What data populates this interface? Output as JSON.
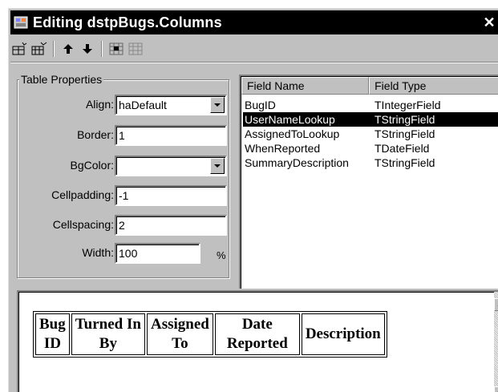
{
  "window": {
    "title": "Editing dstpBugs.Columns",
    "close_glyph": "✕"
  },
  "toolbar": {
    "buttons": [
      {
        "icon": "add-field-icon"
      },
      {
        "icon": "add-all-fields-icon"
      },
      {
        "icon": "move-up-icon"
      },
      {
        "icon": "move-down-icon"
      },
      {
        "icon": "select-all-icon"
      },
      {
        "icon": "grid-icon"
      }
    ]
  },
  "properties": {
    "group_label": "Table Properties",
    "align": {
      "label": "Align:",
      "value": "haDefault"
    },
    "border": {
      "label": "Border:",
      "value": "1"
    },
    "bgcolor": {
      "label": "BgColor:",
      "value": ""
    },
    "cellpadding": {
      "label": "Cellpadding:",
      "value": "-1"
    },
    "cellspacing": {
      "label": "Cellspacing:",
      "value": "2"
    },
    "width": {
      "label": "Width:",
      "value": "100",
      "unit": "%"
    }
  },
  "fields": {
    "columns": [
      "Field Name",
      "Field Type"
    ],
    "rows": [
      {
        "name": "BugID",
        "type": "TIntegerField",
        "selected": false
      },
      {
        "name": "UserNameLookup",
        "type": "TStringField",
        "selected": true
      },
      {
        "name": "AssignedToLookup",
        "type": "TStringField",
        "selected": false
      },
      {
        "name": "WhenReported",
        "type": "TDateField",
        "selected": false
      },
      {
        "name": "SummaryDescription",
        "type": "TStringField",
        "selected": false
      }
    ]
  },
  "preview": {
    "headers": [
      {
        "line1": "Bug",
        "line2": "ID"
      },
      {
        "line1": "Turned In",
        "line2": "By"
      },
      {
        "line1": "Assigned",
        "line2": "To"
      },
      {
        "line1": "Date",
        "line2": "Reported"
      },
      {
        "line1": "Description",
        "line2": ""
      }
    ]
  }
}
